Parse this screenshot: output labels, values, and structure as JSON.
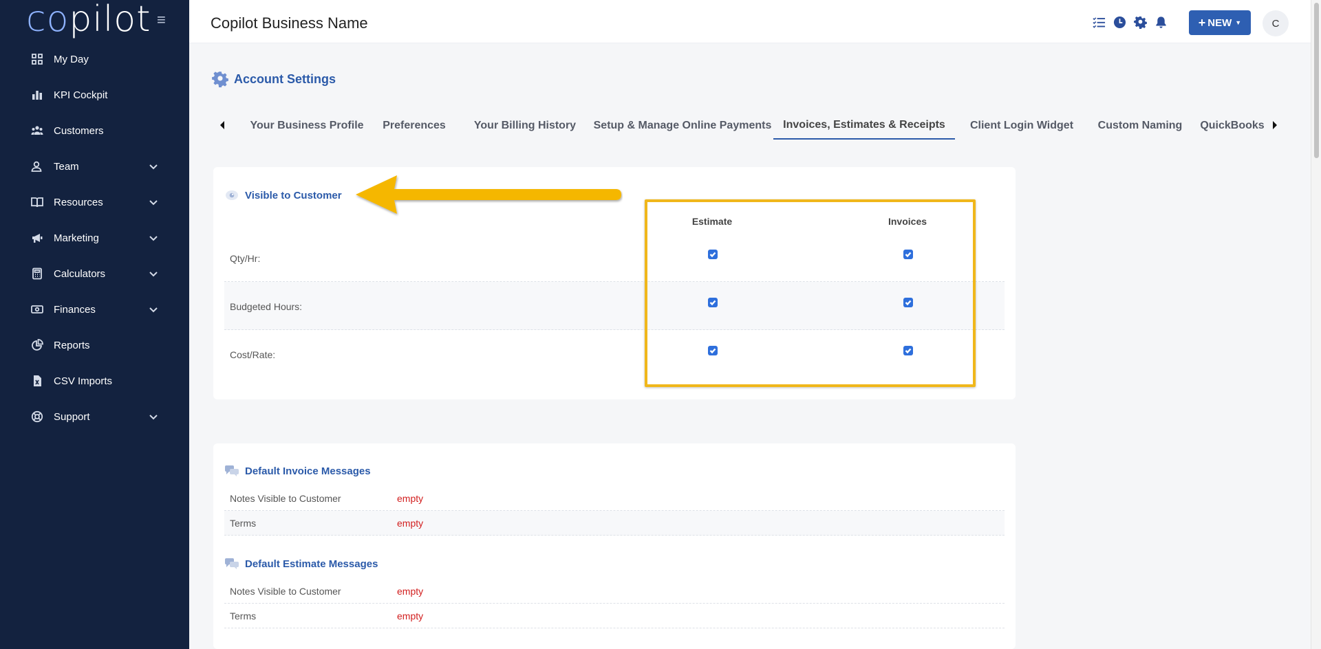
{
  "sidebar": {
    "logo_prefix": "co",
    "logo_suffix": "pilot",
    "items": [
      {
        "label": "My Day",
        "icon": "grid-icon",
        "expandable": false
      },
      {
        "label": "KPI Cockpit",
        "icon": "bar-chart-icon",
        "expandable": false
      },
      {
        "label": "Customers",
        "icon": "people-icon",
        "expandable": false
      },
      {
        "label": "Team",
        "icon": "user-team-icon",
        "expandable": true
      },
      {
        "label": "Resources",
        "icon": "book-icon",
        "expandable": true
      },
      {
        "label": "Marketing",
        "icon": "megaphone-icon",
        "expandable": true
      },
      {
        "label": "Calculators",
        "icon": "calculator-icon",
        "expandable": true
      },
      {
        "label": "Finances",
        "icon": "money-icon",
        "expandable": true
      },
      {
        "label": "Reports",
        "icon": "pie-chart-icon",
        "expandable": false
      },
      {
        "label": "CSV Imports",
        "icon": "csv-file-icon",
        "expandable": false
      },
      {
        "label": "Support",
        "icon": "lifebuoy-icon",
        "expandable": true
      }
    ]
  },
  "header": {
    "business_name": "Copilot Business Name",
    "new_button": "NEW",
    "avatar_initial": "C"
  },
  "page": {
    "title": "Account Settings",
    "tabs": [
      {
        "label": "Your Business Profile",
        "active": false
      },
      {
        "label": "Preferences",
        "active": false
      },
      {
        "label": "Your Billing History",
        "active": false
      },
      {
        "label": "Setup & Manage Online Payments",
        "active": false
      },
      {
        "label": "Invoices, Estimates & Receipts",
        "active": true
      },
      {
        "label": "Client Login Widget",
        "active": false
      },
      {
        "label": "Custom Naming",
        "active": false
      },
      {
        "label": "QuickBooks",
        "active": false
      }
    ]
  },
  "visibility": {
    "title": "Visible to Customer",
    "columns": [
      "Estimate",
      "Invoices"
    ],
    "rows": [
      {
        "label": "Qty/Hr:",
        "estimate": true,
        "invoices": true
      },
      {
        "label": "Budgeted Hours:",
        "estimate": true,
        "invoices": true
      },
      {
        "label": "Cost/Rate:",
        "estimate": true,
        "invoices": true
      }
    ]
  },
  "invoice_messages": {
    "title": "Default Invoice Messages",
    "rows": [
      {
        "label": "Notes Visible to Customer",
        "value": "empty"
      },
      {
        "label": "Terms",
        "value": "empty"
      }
    ]
  },
  "estimate_messages": {
    "title": "Default Estimate Messages",
    "rows": [
      {
        "label": "Notes Visible to Customer",
        "value": "empty"
      },
      {
        "label": "Terms",
        "value": "empty"
      }
    ]
  },
  "colors": {
    "sidebar_bg": "#13223f",
    "accent": "#2b5aa9",
    "highlight": "#f0b71b",
    "empty_value": "#d21f1f"
  }
}
